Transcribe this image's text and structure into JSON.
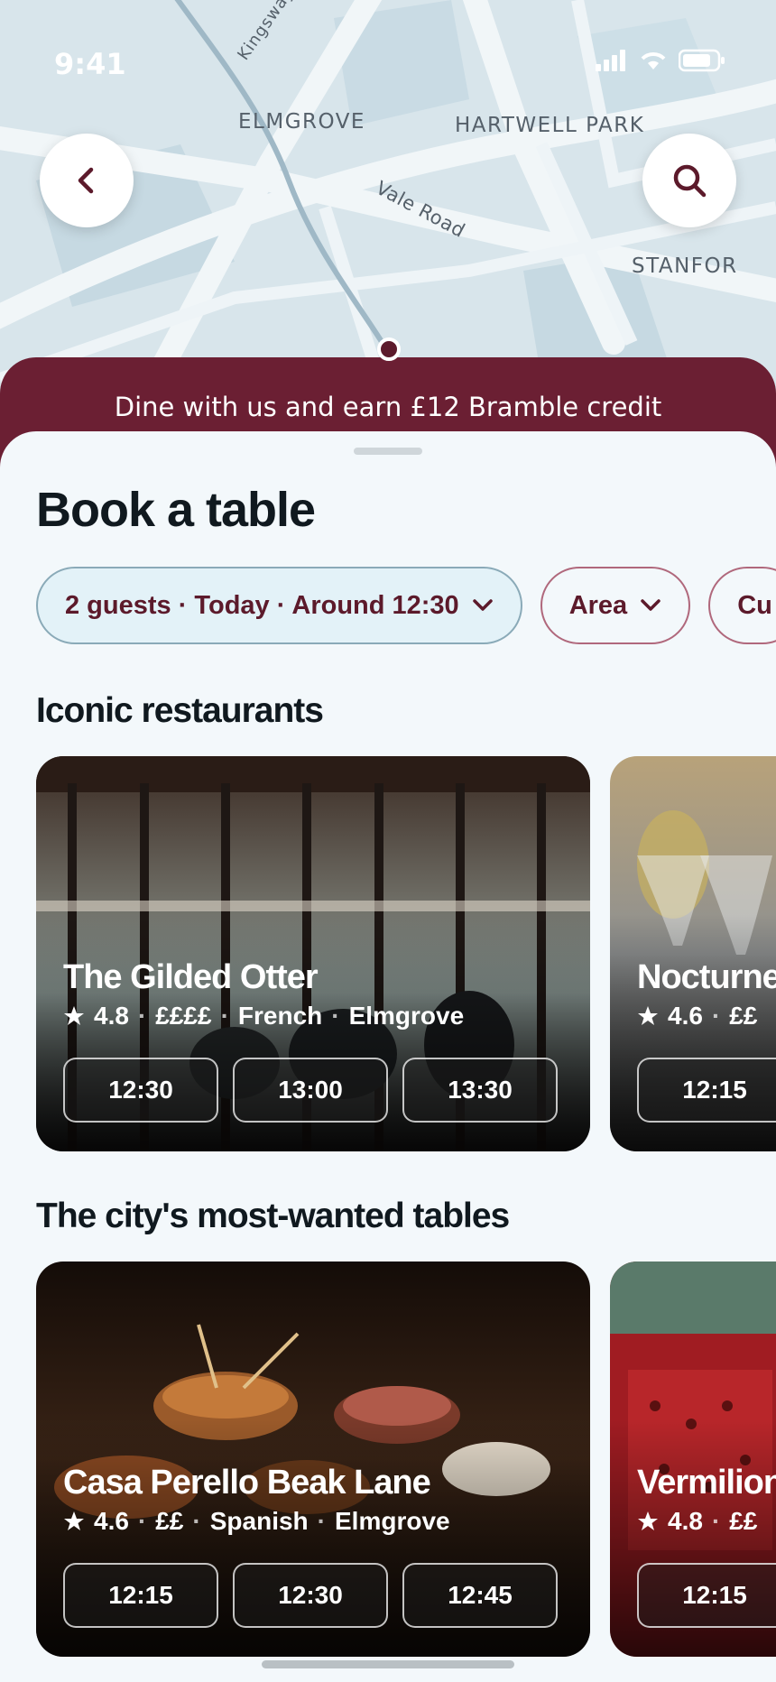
{
  "status_bar": {
    "time": "9:41"
  },
  "map": {
    "labels": {
      "kingsway": "Kingsway",
      "elmgrove": "ELMGROVE",
      "hartwell": "HARTWELL PARK",
      "vale": "Vale Road",
      "stanfor": "STANFOR"
    }
  },
  "nav": {
    "back_icon": "chevron-left-icon",
    "search_icon": "search-icon"
  },
  "banner": {
    "text": "Dine with us and earn £12 Bramble credit"
  },
  "sheet": {
    "title": "Book a table",
    "filters": {
      "party": "2 guests · Today · Around 12:30",
      "area": "Area",
      "cuisine": "Cu"
    }
  },
  "sections": {
    "iconic": {
      "title": "Iconic restaurants",
      "cards": [
        {
          "name": "The Gilded Otter",
          "rating": "4.8",
          "price": "££££",
          "cuisine": "French",
          "area": "Elmgrove",
          "slots": [
            "12:30",
            "13:00",
            "13:30"
          ]
        },
        {
          "name": "Nocturne",
          "rating": "4.6",
          "price": "££",
          "slots": [
            "12:15"
          ]
        }
      ]
    },
    "wanted": {
      "title": "The city's most-wanted tables",
      "cards": [
        {
          "name": "Casa Perello Beak Lane",
          "rating": "4.6",
          "price": "££",
          "cuisine": "Spanish",
          "area": "Elmgrove",
          "slots": [
            "12:15",
            "12:30",
            "12:45"
          ]
        },
        {
          "name": "Vermilion",
          "rating": "4.8",
          "price": "££",
          "slots": [
            "12:15"
          ]
        }
      ]
    }
  },
  "separator": "·",
  "colors": {
    "brand": "#6b1f33",
    "map": "#d9e6ec",
    "background": "#f3f8fb"
  }
}
